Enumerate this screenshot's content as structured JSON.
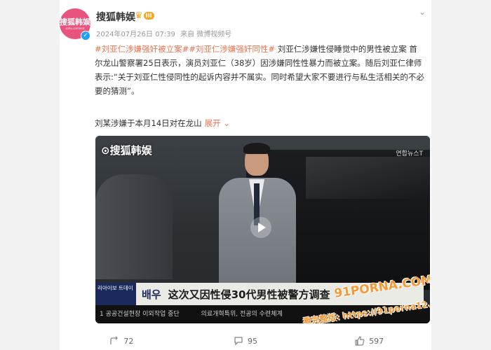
{
  "account": {
    "name": "搜狐韩娱",
    "avatar_text": "搜狐韩娱",
    "avatar_subtext": "sohu.com/ent",
    "vip_level": "III",
    "timestamp": "2024年07月26日 07:39",
    "source": "来自 微博视频号"
  },
  "post": {
    "tag1": "#刘亚仁涉嫌强奸被立案#",
    "tag2": "#刘亚仁涉嫌强奸同性#",
    "body": " 刘亚仁涉嫌性侵睡觉中的男性被立案 首尔龙山警察署25日表示，演员刘亚仁（38岁）因涉嫌同性性暴力而被立案。随后刘亚仁律师表示:“关于刘亚仁性侵同性的起诉内容并不属实。同时希望大家不要进行与私生活相关的不必要的猜测”。",
    "summary": "刘某涉嫌于本月14日对在龙山",
    "expand_label": "展开"
  },
  "video": {
    "watermark_left": "⊙搜狐韩娱",
    "watermark_right": "연합뉴스T",
    "news_left": "리아이보 트데이",
    "news_category": "배우",
    "news_title": "这次又因性侵30代男性被警方调查",
    "ticker1": "1 공공건설현장 이외작업 중단",
    "ticker2": "의료개혁특위, 전공의 수련체계",
    "overlay_brand": "91PORNA.COM",
    "overlay_url": "看完整版: https://91porna12.com"
  },
  "actions": {
    "repost": "72",
    "comment": "95",
    "like": "597"
  },
  "colors": {
    "link": "#eb7350",
    "avatar": "#e8547d",
    "verify": "#1da1f2"
  }
}
